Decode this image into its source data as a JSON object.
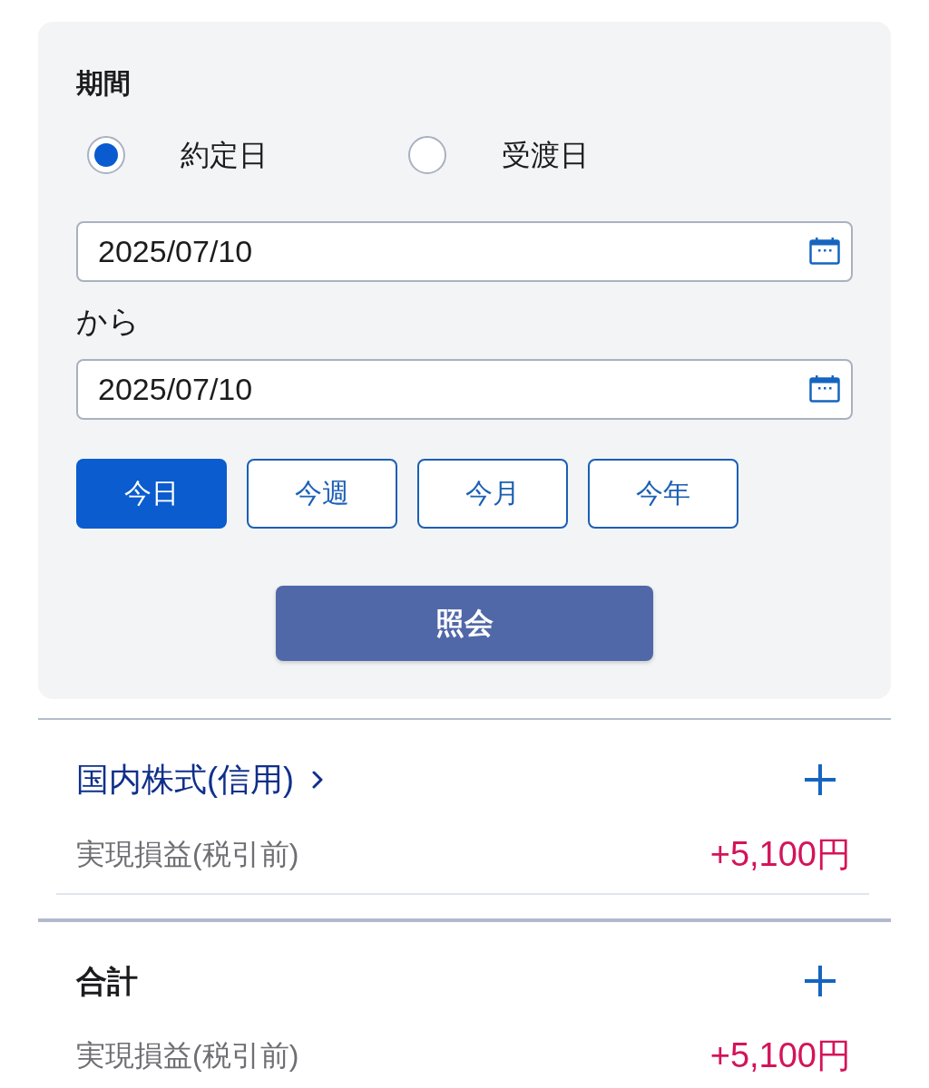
{
  "period": {
    "label": "期間",
    "date_types": [
      {
        "label": "約定日",
        "selected": true
      },
      {
        "label": "受渡日",
        "selected": false
      }
    ],
    "from_date": {
      "value": "2025/07/10"
    },
    "from_suffix": "から",
    "to_date": {
      "value": "2025/07/10"
    },
    "presets": [
      {
        "label": "今日",
        "selected": true
      },
      {
        "label": "今週",
        "selected": false
      },
      {
        "label": "今月",
        "selected": false
      },
      {
        "label": "今年",
        "selected": false
      }
    ],
    "submit": "照会"
  },
  "sections": [
    {
      "kind": "link",
      "title": "国内株式(信用)",
      "rows": [
        {
          "label": "実現損益(税引前)",
          "value": "+5,100円"
        }
      ]
    },
    {
      "kind": "total",
      "title": "合計",
      "rows": [
        {
          "label": "実現損益(税引前)",
          "value": "+5,100円"
        }
      ]
    }
  ]
}
